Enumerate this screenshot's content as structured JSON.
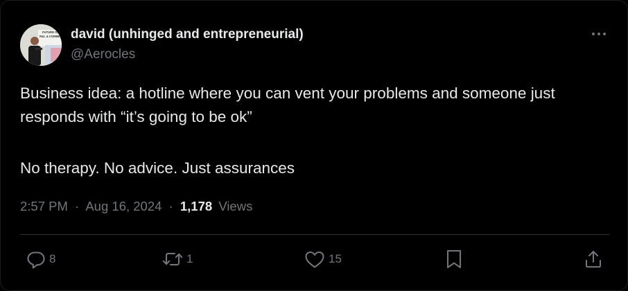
{
  "tweet": {
    "author_name": "david (unhinged and entrepreneurial)",
    "author_handle": "@Aerocles",
    "avatar_text": "FUTURE OF R&L & COMMER",
    "text_line1": "Business idea: a hotline where you can vent your problems and someone just responds with “it’s going to be ok”",
    "text_line2": "No therapy. No advice. Just assurances",
    "time": "2:57 PM",
    "date": "Aug 16, 2024",
    "separator": "·",
    "views_count": "1,178",
    "views_label": "Views"
  },
  "actions": {
    "replies": "8",
    "reposts": "1",
    "likes": "15"
  },
  "icons": {
    "more": "more-dots-icon",
    "reply": "reply-icon",
    "repost": "repost-icon",
    "like": "heart-icon",
    "bookmark": "bookmark-icon",
    "share": "share-icon"
  },
  "colors": {
    "background": "#000000",
    "text": "#e7e9ea",
    "secondary": "#71767b",
    "divider": "#2f3336"
  }
}
